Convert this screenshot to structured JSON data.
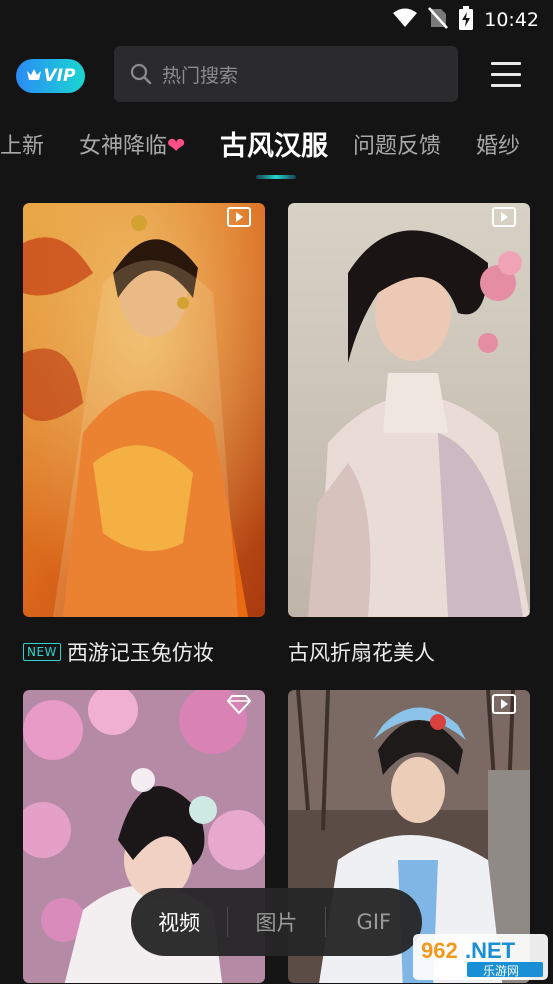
{
  "status_bar": {
    "time": "10:42",
    "icons": [
      "wifi-icon",
      "no-sim-icon",
      "battery-charging-icon"
    ]
  },
  "header": {
    "vip_label": "VIP",
    "search_placeholder": "热门搜索",
    "menu_icon": "hamburger-menu-icon"
  },
  "tabs": [
    {
      "label": "上新",
      "active": false
    },
    {
      "label": "女神降临",
      "active": false,
      "has_heart": true
    },
    {
      "label": "古风汉服",
      "active": true
    },
    {
      "label": "问题反馈",
      "active": false
    },
    {
      "label": "婚纱",
      "active": false
    }
  ],
  "cards": [
    {
      "title": "西游记玉兔仿妆",
      "badge": "NEW",
      "icon": "video-play-icon"
    },
    {
      "title": "古风折扇花美人",
      "badge": "",
      "icon": "video-play-icon"
    },
    {
      "title": "",
      "badge": "",
      "icon": "diamond-icon"
    },
    {
      "title": "",
      "badge": "",
      "icon": "video-play-icon"
    }
  ],
  "bottom_bar": {
    "items": [
      "视频",
      "图片",
      "GIF"
    ],
    "active": "视频"
  },
  "watermark": {
    "line1": "962.NET",
    "line2": "乐游网"
  },
  "colors": {
    "accent": "#21d6cc",
    "vip_start": "#2a8cf6",
    "vip_end": "#1ad6d1",
    "heart": "#ff4f86",
    "background": "#141414"
  }
}
